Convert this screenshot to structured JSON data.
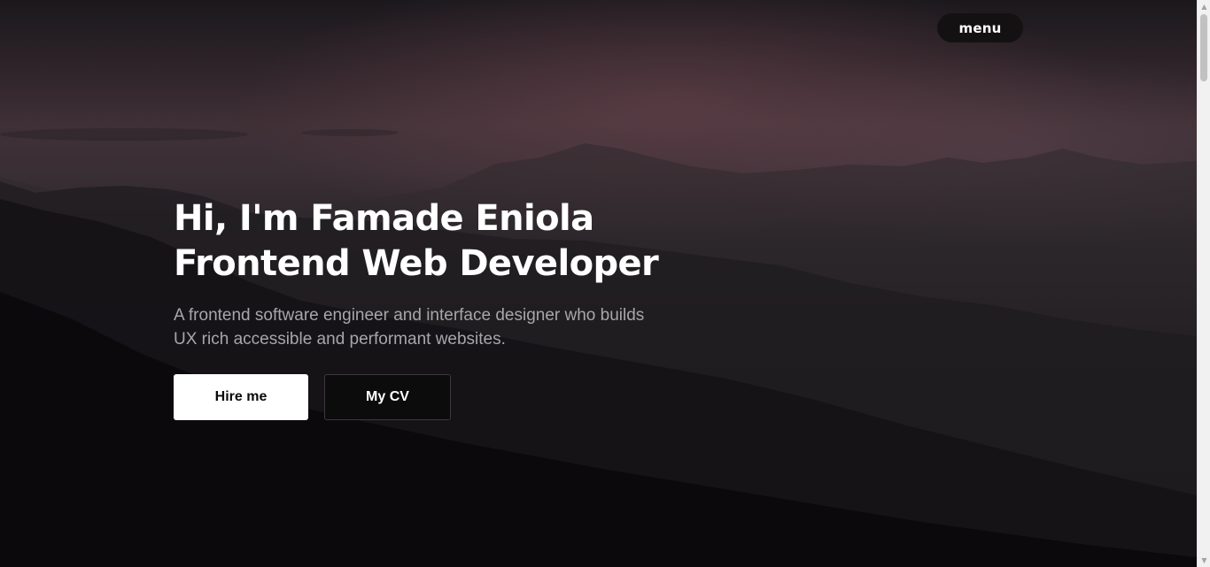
{
  "nav": {
    "menu_label": "menu"
  },
  "hero": {
    "headline_line1": "Hi, I'm Famade Eniola",
    "headline_line2": "Frontend Web Developer",
    "subtitle": "A frontend software engineer and interface designer who builds UX rich accessible and performant websites."
  },
  "actions": {
    "hire_label": "Hire me",
    "cv_label": "My CV"
  },
  "scrollbar": {
    "up_icon": "chevron-up-icon",
    "down_icon": "chevron-down-icon"
  },
  "colors": {
    "text_primary": "#ffffff",
    "text_muted": "#a9a6a9",
    "button_light": "#ffffff",
    "button_dark": "#0d0c0d",
    "menu_pill": "#141112"
  }
}
